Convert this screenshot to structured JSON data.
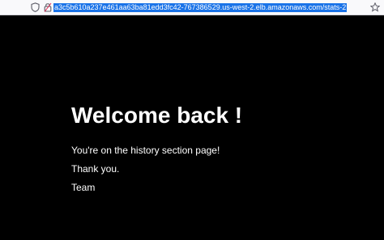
{
  "browser": {
    "url": "a3c5b610a237e461aa63ba81edd3fc42-767386529.us-west-2.elb.amazonaws.com/stats-2",
    "icons": [
      "shield-icon",
      "lock-icon",
      "star-icon"
    ]
  },
  "page": {
    "heading": "Welcome back !",
    "line1": "You're on the history section page!",
    "line2": "Thank you.",
    "line3": "Team"
  },
  "colors": {
    "background": "#000000",
    "text": "#ffffff",
    "url_highlight": "#1a73e8"
  }
}
